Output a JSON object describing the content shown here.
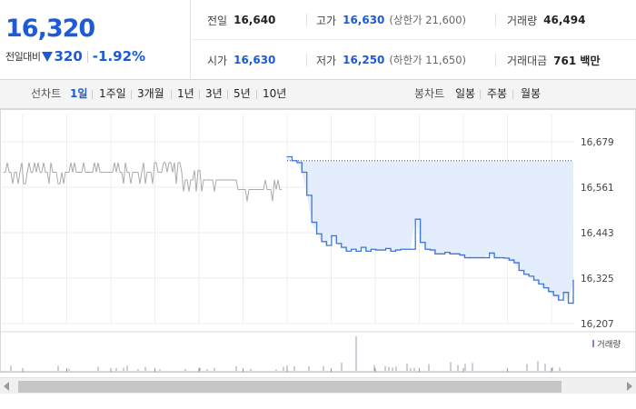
{
  "quote": {
    "price": "16,320",
    "change_label": "전일대비",
    "change_value": "320",
    "change_percent": "-1.92%",
    "direction": "down-triangle-icon"
  },
  "stats": {
    "prev_close_label": "전일",
    "prev_close": "16,640",
    "high_label": "고가",
    "high": "16,630",
    "upper_limit": "(상한가 21,600)",
    "volume_label": "거래량",
    "volume": "46,494",
    "open_label": "시가",
    "open": "16,630",
    "low_label": "저가",
    "low": "16,250",
    "lower_limit": "(하한가 11,650)",
    "turnover_label": "거래대금",
    "turnover": "761 백만"
  },
  "periods": {
    "line_label": "선차트",
    "line_items": [
      "1일",
      "1주일",
      "3개월",
      "1년",
      "3년",
      "5년",
      "10년"
    ],
    "active": "1일",
    "candle_label": "봉차트",
    "candle_items": [
      "일봉",
      "주봉",
      "월봉"
    ]
  },
  "colors": {
    "accent": "#1d5bd6",
    "line": "#3f77d6",
    "fill": "#e4edfb",
    "prev_line": "#aaaaaa"
  },
  "chart_data": {
    "type": "line",
    "title": "",
    "ylim": [
      16207,
      16679
    ],
    "yticks": [
      "16,679",
      "16,561",
      "16,443",
      "16,325",
      "16,207"
    ],
    "prev_close_reference": 16630,
    "series": [
      {
        "values": [
          16640,
          16630,
          16625,
          16600,
          16540,
          16470,
          16440,
          16420,
          16410,
          16435,
          16415,
          16405,
          16395,
          16400,
          16395,
          16405,
          16395,
          16400,
          16398,
          16398,
          16402,
          16395,
          16398,
          16400,
          16400,
          16400,
          16478,
          16418,
          16400,
          16398,
          16388,
          16388,
          16392,
          16388,
          16388,
          16385,
          16378,
          16378,
          16378,
          16378,
          16378,
          16390,
          16378,
          16378,
          16377,
          16372,
          16365,
          16345,
          16335,
          16330,
          16320,
          16310,
          16300,
          16290,
          16280,
          16268,
          16288,
          16260,
          16320
        ]
      }
    ],
    "volume_label": "거래량"
  }
}
